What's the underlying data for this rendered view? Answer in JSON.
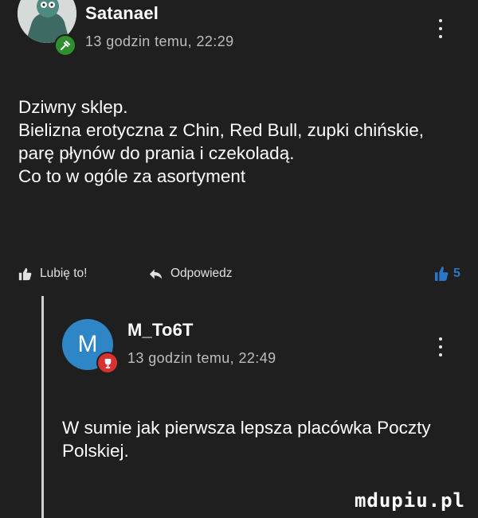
{
  "comment": {
    "username": "Satanael",
    "timestamp": "13 godzin temu, 22:29",
    "body_lines": [
      "Dziwny sklep.",
      "Bielizna erotyczna z Chin, Red Bull, zupki chińskie,",
      "parę płynów do prania i czekoladą.",
      "Co to w ogóle za asortyment"
    ],
    "like_label": "Lubię to!",
    "reply_label": "Odpowiedz",
    "like_count": "5"
  },
  "reply": {
    "avatar_letter": "M",
    "username": "M_To6T",
    "timestamp": "13 godzin temu, 22:49",
    "body_lines": [
      "W sumie jak pierwsza lepsza placówka Poczty",
      "Polskiej."
    ]
  },
  "watermark": "mdupiu.pl",
  "colors": {
    "background": "#1f1f1f",
    "like_accent": "#2a76c9",
    "avatar_blue": "#2f86c7",
    "badge_green": "#2f8f2f",
    "badge_red": "#d93030"
  },
  "icons": {
    "like": "thumbs-up-icon",
    "reply": "reply-arrow-icon",
    "menu": "more-vertical-icon"
  }
}
